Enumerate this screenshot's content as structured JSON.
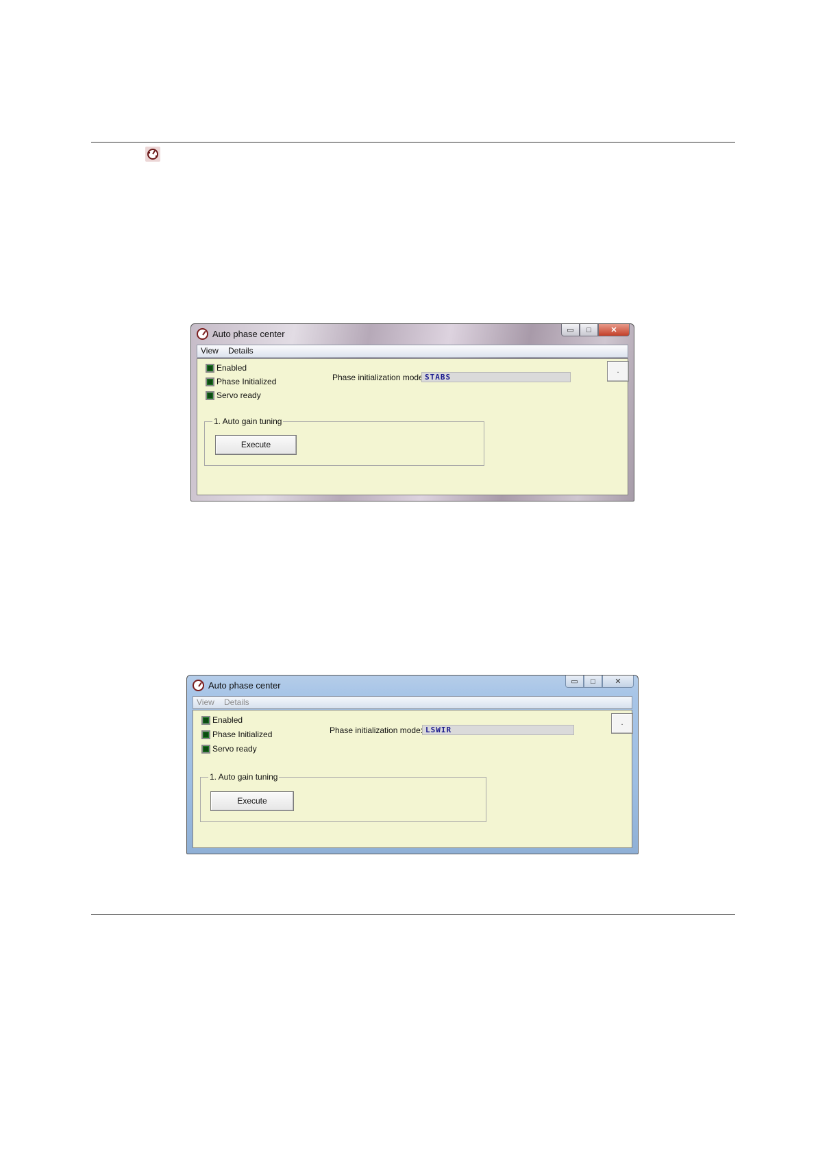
{
  "windows": [
    {
      "title": "Auto phase center",
      "controls": {
        "minimize": "▭",
        "maximize": "□",
        "close": "✕"
      },
      "menu": [
        "View",
        "Details"
      ],
      "status": [
        "Enabled",
        "Phase Initialized",
        "Servo ready"
      ],
      "mode_label": "Phase initialization mode:",
      "mode_value": "STABS",
      "side_button": ".",
      "group_title": "1. Auto gain tuning",
      "execute_label": "Execute"
    },
    {
      "title": "Auto phase center",
      "controls": {
        "minimize": "▭",
        "maximize": "□",
        "close": "✕"
      },
      "menu": [
        "View",
        "Details"
      ],
      "status": [
        "Enabled",
        "Phase Initialized",
        "Servo ready"
      ],
      "mode_label": "Phase initialization mode:",
      "mode_value": "LSWIR",
      "side_button": ".",
      "group_title": "1. Auto gain tuning",
      "execute_label": "Execute"
    }
  ]
}
